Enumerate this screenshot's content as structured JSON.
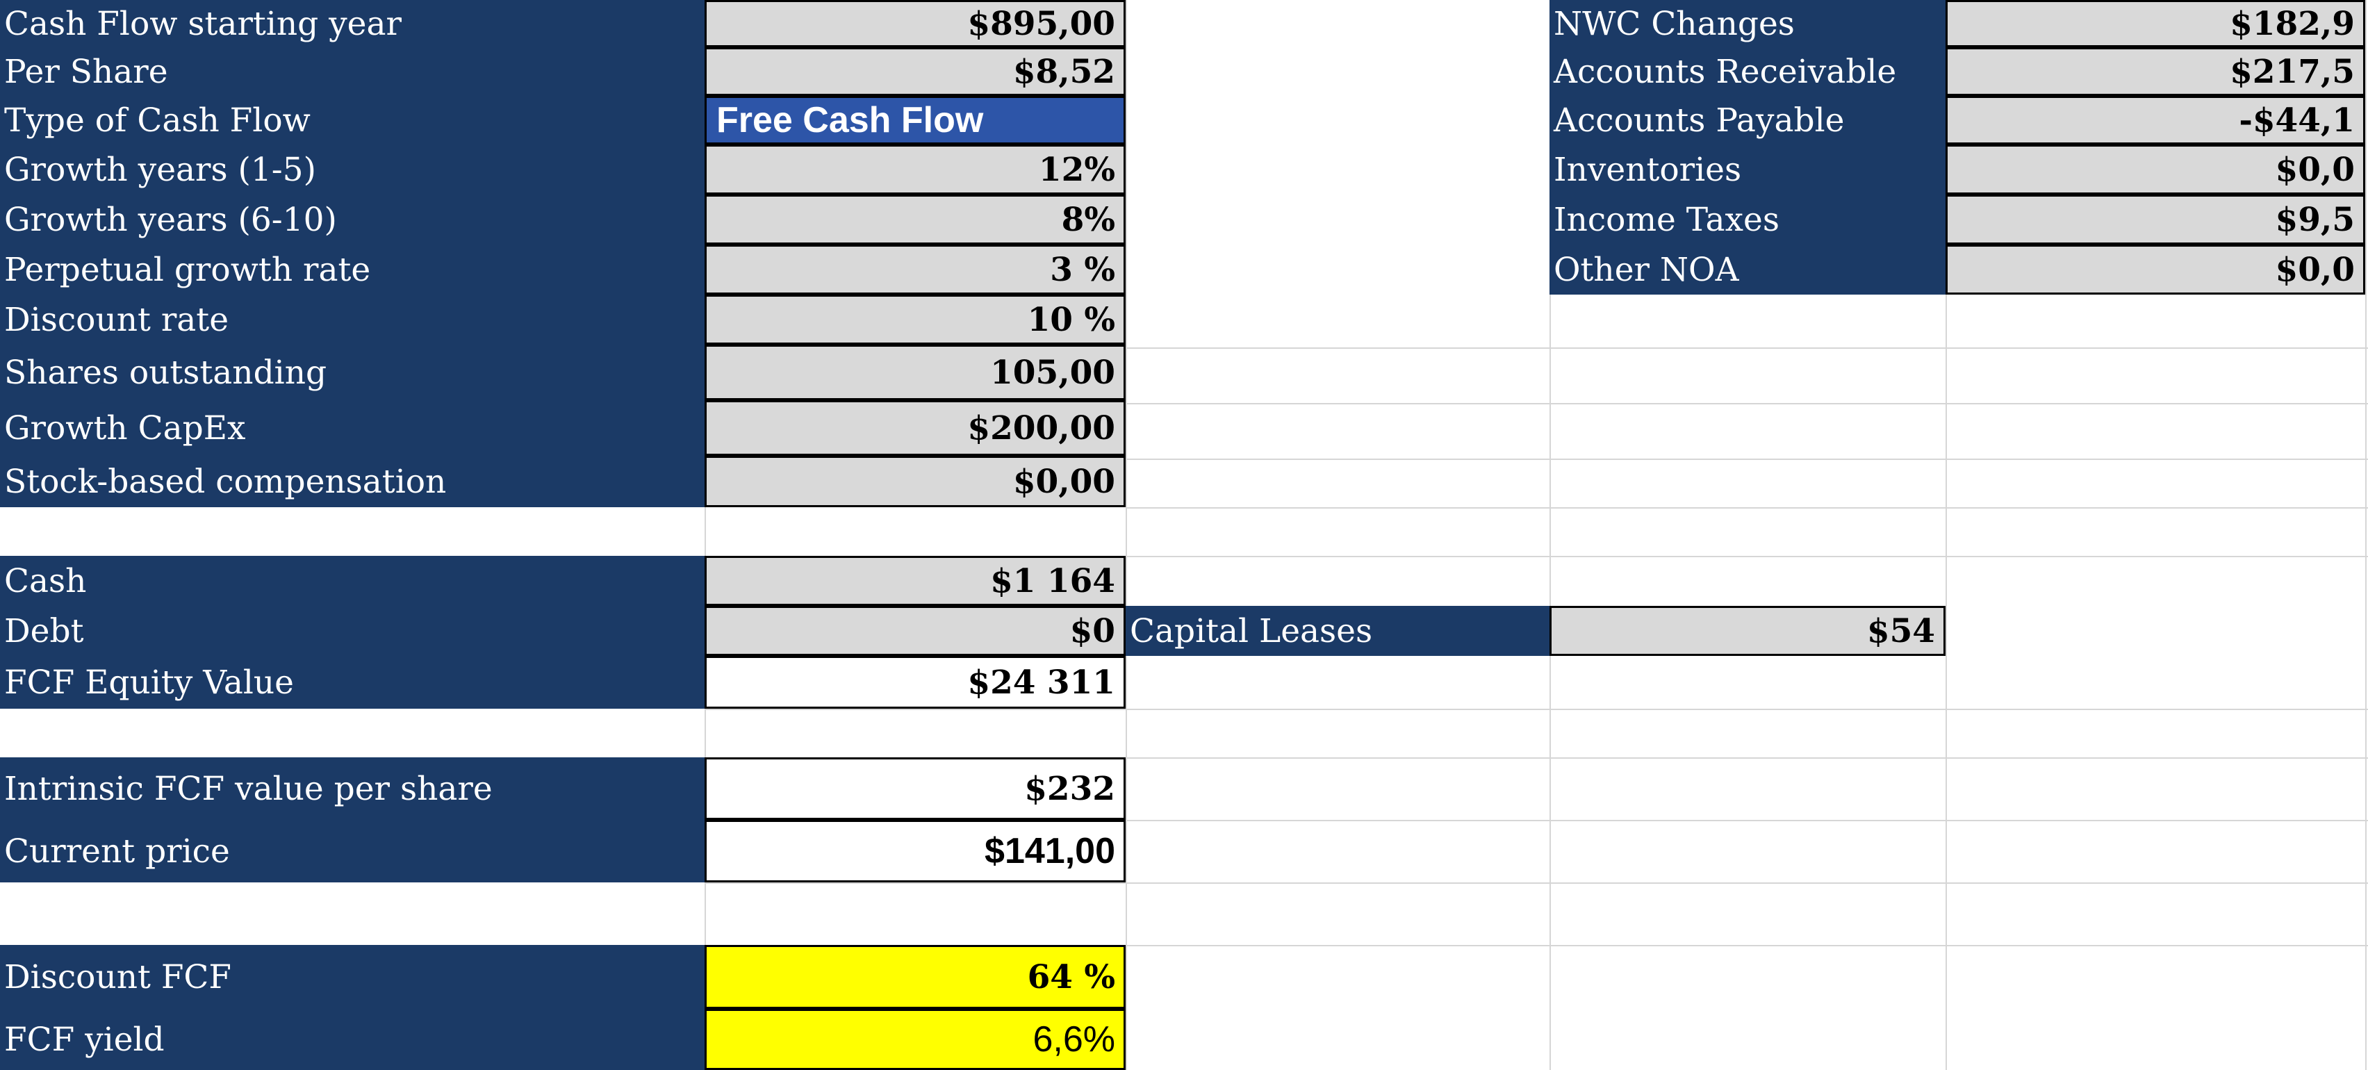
{
  "left_rows": [
    {
      "label": "Cash Flow starting year",
      "value": "$895,00"
    },
    {
      "label": "Per Share",
      "value": "$8,52"
    },
    {
      "label": "Type of Cash Flow",
      "value": "Free Cash Flow"
    },
    {
      "label": "Growth years (1-5)",
      "value": "12%"
    },
    {
      "label": "Growth years (6-10)",
      "value": "8%"
    },
    {
      "label": "Perpetual growth rate",
      "value": "3 %"
    },
    {
      "label": "Discount rate",
      "value": "10 %"
    },
    {
      "label": "Shares outstanding",
      "value": "105,00"
    },
    {
      "label": "Growth CapEx",
      "value": "$200,00"
    },
    {
      "label": "Stock-based compensation",
      "value": "$0,00"
    }
  ],
  "balance": {
    "cash": {
      "label": "Cash",
      "value": "$1 164"
    },
    "debt": {
      "label": "Debt",
      "value": "$0"
    },
    "equity": {
      "label": "FCF Equity Value",
      "value": "$24 311"
    },
    "leases": {
      "label": "Capital Leases",
      "value": "$54"
    }
  },
  "valuation": {
    "intrinsic": {
      "label": "Intrinsic FCF value per share",
      "value": "$232"
    },
    "price": {
      "label": "Current price",
      "value": "$141,00"
    },
    "discount": {
      "label": "Discount FCF",
      "value": "64 %"
    },
    "yield": {
      "label": "FCF yield",
      "value": "6,6%"
    }
  },
  "nwc_rows": [
    {
      "label": "NWC Changes",
      "value": "$182,9"
    },
    {
      "label": "Accounts Receivable",
      "value": "$217,5"
    },
    {
      "label": "Accounts Payable",
      "value": "-$44,1"
    },
    {
      "label": "Inventories",
      "value": "$0,0"
    },
    {
      "label": "Income Taxes",
      "value": "$9,5"
    },
    {
      "label": "Other NOA",
      "value": "$0,0"
    }
  ],
  "colors": {
    "label_bg": "#1b3a66",
    "value_bg": "#d9d9d9",
    "highlight": "#ffff00",
    "dropdown_bg": "#2d55a8"
  }
}
